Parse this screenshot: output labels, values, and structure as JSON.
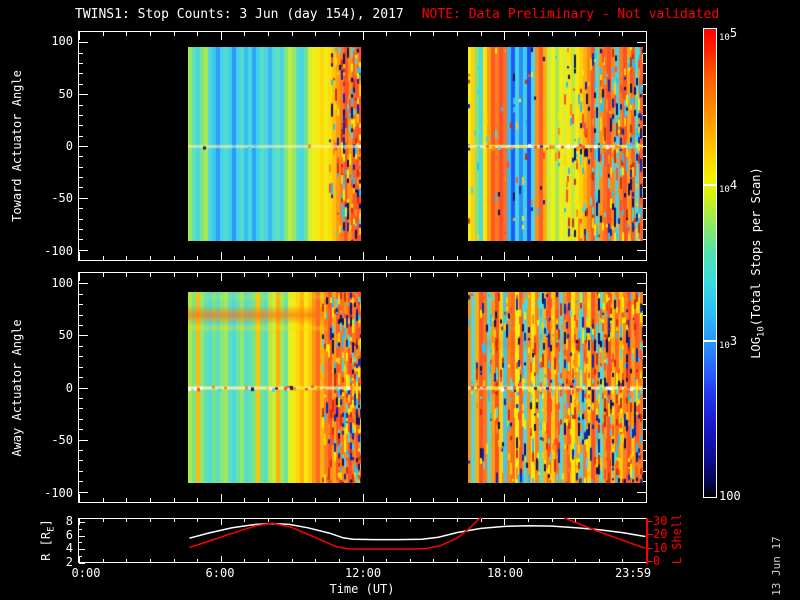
{
  "title": {
    "main": "TWINS1: Stop Counts:  3 Jun (day 154), 2017",
    "note": "NOTE: Data Preliminary - Not validated"
  },
  "datestamp": "13 Jun 17",
  "colors": {
    "background": "#000000",
    "axis": "#ffffff",
    "note": "#ff0000",
    "lshell_axis": "#ff0000",
    "r_curve": "#ffffff",
    "l_curve": "#ff0000",
    "datestamp": "#cfcfcf"
  },
  "axes": {
    "toward": {
      "label": "Toward Actuator Angle",
      "ticks": [
        "100",
        "50",
        "0",
        "-50",
        "-100"
      ]
    },
    "away": {
      "label": "Away Actuator Angle",
      "ticks": [
        "100",
        "50",
        "0",
        "-50",
        "-100"
      ]
    },
    "time": {
      "label": "Time (UT)",
      "ticks": [
        "0:00",
        "6:00",
        "12:00",
        "18:00",
        "23:59"
      ]
    },
    "r": {
      "label_pre": "R [R",
      "label_sub": "E",
      "label_post": "]",
      "ticks": [
        "8",
        "6",
        "4",
        "2"
      ]
    },
    "lshell": {
      "label": "L Shell",
      "ticks": [
        "30",
        "20",
        "10",
        "0"
      ]
    },
    "colorbar": {
      "label_pre": "LOG",
      "label_sub": "10",
      "label_post": "(Total Stops per Scan)",
      "tick5_base": "10",
      "tick5_exp": "5",
      "tick4_base": "10",
      "tick4_exp": "4",
      "tick3_base": "10",
      "tick3_exp": "3",
      "tick_bottom": "100"
    }
  },
  "chart_data": {
    "type": "heatmap",
    "title": "TWINS1: Stop Counts: 3 Jun (day 154), 2017",
    "x_range_hours": [
      0,
      23.983
    ],
    "angle_range": [
      -110,
      110
    ],
    "colorbar": {
      "scale": "log10",
      "range": [
        100,
        100000
      ],
      "label": "LOG10(Total Stops per Scan)",
      "stops": [
        [
          0.0,
          "#ff0000"
        ],
        [
          0.04,
          "#ff1e00"
        ],
        [
          0.1,
          "#ff5a00"
        ],
        [
          0.18,
          "#ff9000"
        ],
        [
          0.26,
          "#ffc800"
        ],
        [
          0.32,
          "#f4f000"
        ],
        [
          0.36,
          "#d0f018"
        ],
        [
          0.42,
          "#8ce860"
        ],
        [
          0.48,
          "#50e0b0"
        ],
        [
          0.54,
          "#38dce0"
        ],
        [
          0.6,
          "#2cc0f4"
        ],
        [
          0.67,
          "#2894ff"
        ],
        [
          0.72,
          "#2a6aff"
        ],
        [
          0.78,
          "#2238f0"
        ],
        [
          0.85,
          "#1818c8"
        ],
        [
          0.92,
          "#0c0c90"
        ],
        [
          0.97,
          "#050550"
        ],
        [
          1.0,
          "#000000"
        ]
      ]
    },
    "chaos_palette": [
      "#ff4e2c",
      "#ff8c16",
      "#ffd00c",
      "#4ed8da",
      "#0a28b0",
      "#f0f000",
      "#2cc0f4",
      "#d03008",
      "#101060"
    ],
    "angle0_palette": [
      "#ffd00c",
      "#ff8c16",
      "#fa4e2c",
      "#4ed8da",
      "#141478",
      "#f0f000",
      "#ffffff"
    ],
    "panels": [
      {
        "name": "toward",
        "blocks": [
          {
            "t0": 4.64,
            "t1": 11.92,
            "angle0_y": 0.51,
            "angle0_strong": false,
            "chaos_start": 0.82,
            "chaos_density": 0.55,
            "speckle_all": false,
            "bands": [],
            "stripes": [
              "#9ce860",
              "#60e0b8",
              "#48d6e2",
              "#80e680",
              "#a8e854",
              "#4cd8e0",
              "#3cc8ee",
              "#2e9ef6",
              "#46d4e8",
              "#54dcd0",
              "#40d0ec",
              "#2c96f8",
              "#44d2ea",
              "#52dcd2",
              "#3abef2",
              "#48d6e4",
              "#2ea4f6",
              "#40d0ee",
              "#56dec8",
              "#4ad6e0",
              "#38b8f4",
              "#50dad6",
              "#5ee0c0",
              "#46d4e6",
              "#88e678",
              "#c2ee40",
              "#98e866",
              "#54dcce",
              "#48d6e2",
              "#70e296",
              "#d6f032",
              "#ecf01a",
              "#f6ea10",
              "#ffd80a",
              "#f0ee16",
              "#ffdc08",
              "#ffc00c",
              "#ff9a12",
              "#ff7a1e",
              "#fa5228",
              "#ff9412",
              "#f86424",
              "#ff4e2e"
            ]
          },
          {
            "t0": 16.45,
            "t1": 23.83,
            "angle0_y": 0.51,
            "angle0_strong": true,
            "chaos_start": 0.55,
            "chaos_density": 0.3,
            "speckle_all": true,
            "bands": [],
            "stripes": [
              "#f0ee18",
              "#ffd00a",
              "#7ee484",
              "#4ed8dc",
              "#ffe608",
              "#ff9c12",
              "#fa5a26",
              "#ff7c1c",
              "#ff4e2e",
              "#f87022",
              "#38b8f4",
              "#1e5cf8",
              "#46d4e8",
              "#2a8cf6",
              "#40d0ec",
              "#2050f0",
              "#4ad6e4",
              "#ff8c16",
              "#fa5e26",
              "#ffae0e",
              "#c6ee3e",
              "#eef014",
              "#a6e858",
              "#f2ec14",
              "#d4f034",
              "#ffe408",
              "#bce846",
              "#f6ea10",
              "#ffd00a",
              "#ffb00e",
              "#ff8616",
              "#fa5a28",
              "#50dad6",
              "#ff9212",
              "#ff6c20",
              "#fa4e2c",
              "#ff8816",
              "#44d2ea",
              "#ff7a1e",
              "#f85426",
              "#ffa210",
              "#fa6022",
              "#52dcd2",
              "#ff5a28"
            ]
          }
        ]
      },
      {
        "name": "away",
        "blocks": [
          {
            "t0": 4.64,
            "t1": 11.92,
            "angle0_y": 0.5,
            "angle0_strong": true,
            "chaos_start": 0.78,
            "chaos_density": 0.6,
            "speckle_all": false,
            "bands": [
              {
                "y": 0.0,
                "h": 0.05,
                "color": "#d8e830",
                "alpha": 0.3,
                "x0": 0.0,
                "x1": 0.8
              },
              {
                "y": 0.07,
                "h": 0.1,
                "color": "#ff7010",
                "alpha": 0.7,
                "x0": 0.0,
                "x1": 0.82
              },
              {
                "y": 0.17,
                "h": 0.04,
                "color": "#ffe000",
                "alpha": 0.4,
                "x0": 0.0,
                "x1": 0.8
              }
            ],
            "stripes": [
              "#aae852",
              "#7ce482",
              "#ffb80c",
              "#8ae87c",
              "#64e0b0",
              "#52dcd2",
              "#78e48a",
              "#5cdec2",
              "#88e67a",
              "#a2e85c",
              "#5adec6",
              "#4ed8da",
              "#6ce2a0",
              "#92e86e",
              "#56dcca",
              "#62e0b6",
              "#7ee480",
              "#ffc40c",
              "#70e296",
              "#5adec4",
              "#b4e84a",
              "#caee3a",
              "#ffb00e",
              "#9ce862",
              "#6ae2a4",
              "#e4f022",
              "#f2ec14",
              "#ffd40a",
              "#ffb00e",
              "#f6ea10",
              "#ffca0c",
              "#ff9412",
              "#fa6c20",
              "#ffb20e",
              "#ff7e1c",
              "#fa5428",
              "#ffa210",
              "#ff5c26",
              "#f67424",
              "#ff8e14",
              "#fa4e2c",
              "#ff761e",
              "#f85626"
            ]
          },
          {
            "t0": 16.45,
            "t1": 23.83,
            "angle0_y": 0.5,
            "angle0_strong": true,
            "chaos_start": 0.05,
            "chaos_density": 0.3,
            "speckle_all": true,
            "bands": [
              {
                "y": 0.22,
                "h": 0.1,
                "color": "#f05010",
                "alpha": 0.22,
                "x0": 0.1,
                "x1": 0.95
              }
            ],
            "stripes": [
              "#ff8e16",
              "#50dad8",
              "#ffb00e",
              "#fa5628",
              "#ff761e",
              "#54dcce",
              "#ff9c12",
              "#f85228",
              "#ffd20a",
              "#3ec8ee",
              "#ff8616",
              "#fa6c20",
              "#f0f014",
              "#ff5c26",
              "#4ad6e4",
              "#ff9412",
              "#f6ea10",
              "#ff7e1c",
              "#58dec8",
              "#ffb00e",
              "#fa4e2c",
              "#ffca0c",
              "#ff6c20",
              "#4cd8e0",
              "#ff8e16",
              "#f86224",
              "#ffe608",
              "#ff9c12",
              "#46d4e8",
              "#ff761e",
              "#ffd60a",
              "#fa5628",
              "#ff8616",
              "#5adec6",
              "#ff9412",
              "#f85426",
              "#ffb80c",
              "#ff6c20",
              "#ffc40c",
              "#ff7e1c",
              "#fa5028",
              "#ff9c12",
              "#ff5c26",
              "#f67622"
            ]
          }
        ]
      }
    ],
    "line_panel": {
      "r_series": {
        "name": "R [RE]",
        "color": "#ffffff",
        "axis_ticks": [
          2,
          4,
          6,
          8
        ],
        "points": [
          [
            4.7,
            5.45
          ],
          [
            5.5,
            6.2
          ],
          [
            6.5,
            7.0
          ],
          [
            7.5,
            7.5
          ],
          [
            8.2,
            7.62
          ],
          [
            8.9,
            7.5
          ],
          [
            9.7,
            7.0
          ],
          [
            10.6,
            6.2
          ],
          [
            11.2,
            5.5
          ],
          [
            11.6,
            5.3
          ],
          [
            12.5,
            5.25
          ],
          [
            13.5,
            5.25
          ],
          [
            14.5,
            5.3
          ],
          [
            15.2,
            5.6
          ],
          [
            16.0,
            6.3
          ],
          [
            17.0,
            6.9
          ],
          [
            18.0,
            7.2
          ],
          [
            19.0,
            7.3
          ],
          [
            20.0,
            7.25
          ],
          [
            21.0,
            7.0
          ],
          [
            22.0,
            6.7
          ],
          [
            23.0,
            6.25
          ],
          [
            23.93,
            5.7
          ]
        ]
      },
      "l_series": {
        "name": "L Shell",
        "color": "#ff0000",
        "axis_ticks": [
          0,
          10,
          20,
          30
        ],
        "segments": [
          [
            [
              4.7,
              10
            ],
            [
              5.5,
              14.5
            ],
            [
              6.5,
              20.5
            ],
            [
              7.5,
              26
            ],
            [
              8.2,
              28
            ],
            [
              9.0,
              25
            ],
            [
              10.0,
              17.5
            ],
            [
              10.9,
              10.5
            ],
            [
              11.4,
              9.0
            ],
            [
              12.0,
              8.8
            ],
            [
              13.0,
              8.8
            ],
            [
              14.0,
              8.8
            ],
            [
              14.7,
              9.2
            ],
            [
              15.3,
              11.5
            ],
            [
              16.0,
              17
            ],
            [
              16.5,
              24
            ],
            [
              16.9,
              31
            ],
            [
              17.05,
              32
            ]
          ],
          [
            [
              20.5,
              32
            ],
            [
              21.2,
              27
            ],
            [
              22.0,
              21.5
            ],
            [
              22.8,
              16.5
            ],
            [
              23.5,
              12
            ],
            [
              23.93,
              9.5
            ]
          ]
        ]
      }
    }
  }
}
